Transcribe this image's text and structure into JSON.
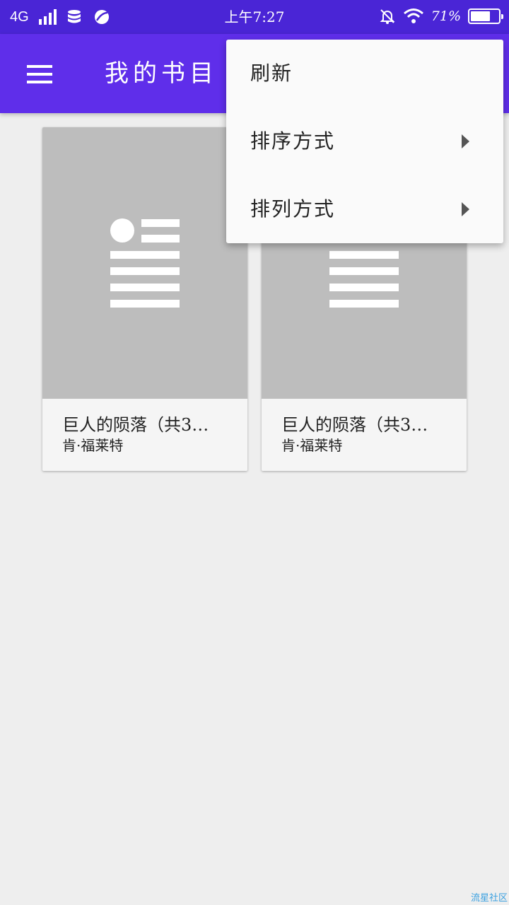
{
  "status_bar": {
    "network": "4G",
    "time": "上午7:27",
    "battery_percent": "71%",
    "battery_level": 0.71,
    "icons": [
      "signal-icon",
      "data-icon",
      "browser-icon",
      "alarm-off-icon",
      "wifi-icon",
      "battery-icon"
    ]
  },
  "app_bar": {
    "title": "我的书目",
    "menu_icon": "hamburger-icon"
  },
  "books": [
    {
      "title": "巨人的陨落（共3…",
      "author": "肯·福莱特"
    },
    {
      "title": "巨人的陨落（共3…",
      "author": "肯·福莱特"
    }
  ],
  "overflow_menu": {
    "items": [
      {
        "label": "刷新",
        "has_submenu": false
      },
      {
        "label": "排序方式",
        "has_submenu": true
      },
      {
        "label": "排列方式",
        "has_submenu": true
      }
    ]
  },
  "watermark": "流星社区",
  "colors": {
    "status_bar": "#4a25d6",
    "app_bar": "#5f2eea",
    "background": "#eeeeee",
    "cover": "#bdbdbd"
  }
}
